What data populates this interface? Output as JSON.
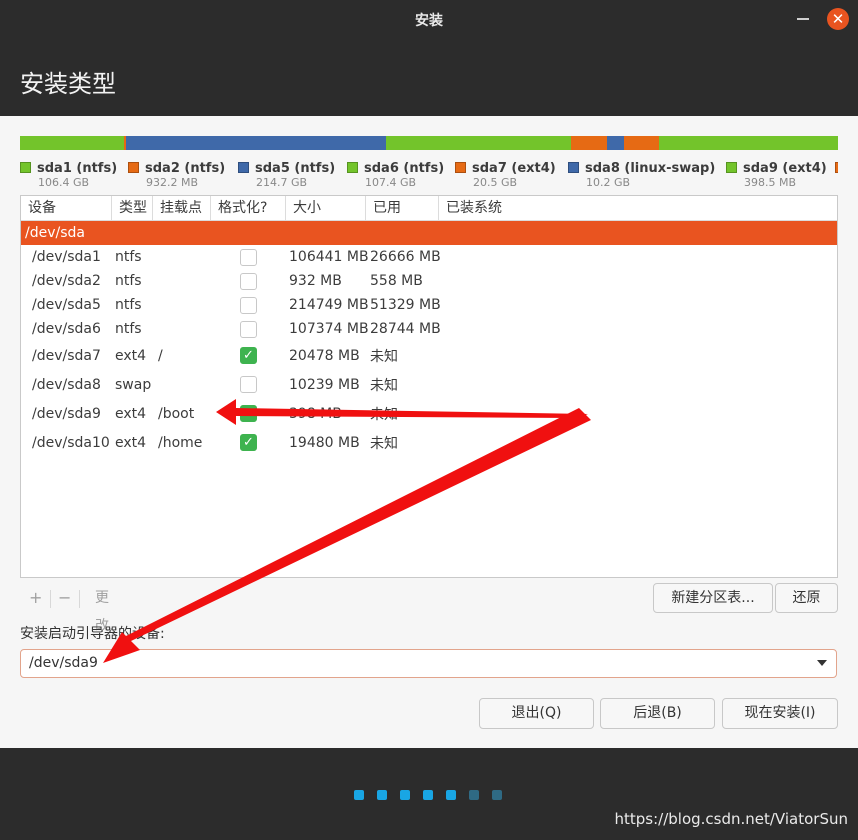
{
  "window": {
    "title": "安装",
    "close_glyph": "✕"
  },
  "header": {
    "title": "安装类型"
  },
  "partition_bar": {
    "segments": [
      {
        "color": "#73c42b",
        "share": 0.127
      },
      {
        "color": "#e66a14",
        "share": 0.003
      },
      {
        "color": "#3f69a9",
        "share": 0.318
      },
      {
        "color": "#73c42b",
        "share": 0.225
      },
      {
        "color": "#e66a14",
        "share": 0.044
      },
      {
        "color": "#3f69a9",
        "share": 0.021
      },
      {
        "color": "#e66a14",
        "share": 0.043
      },
      {
        "color": "#73c42b",
        "share": 0.219
      }
    ]
  },
  "legend": [
    {
      "name": "sda1 (ntfs)",
      "size": "106.4 GB",
      "color": "#73c42b"
    },
    {
      "name": "sda2 (ntfs)",
      "size": "932.2 MB",
      "color": "#e66a14"
    },
    {
      "name": "sda5 (ntfs)",
      "size": "214.7 GB",
      "color": "#3f69a9"
    },
    {
      "name": "sda6 (ntfs)",
      "size": "107.4 GB",
      "color": "#73c42b"
    },
    {
      "name": "sda7 (ext4)",
      "size": "20.5 GB",
      "color": "#e66a14"
    },
    {
      "name": "sda8 (linux-swap)",
      "size": "10.2 GB",
      "color": "#3f69a9"
    },
    {
      "name": "sda9 (ext4)",
      "size": "398.5 MB",
      "color": "#73c42b"
    },
    {
      "name": "",
      "size": "",
      "color": "#e66a14"
    }
  ],
  "table": {
    "headers": [
      "设备",
      "类型",
      "挂载点",
      "格式化?",
      "大小",
      "已用",
      "已装系统"
    ],
    "disk": "/dev/sda",
    "rows": [
      {
        "device": "/dev/sda1",
        "type": "ntfs",
        "mount": "",
        "format": false,
        "size": "106441 MB",
        "used": "26666 MB"
      },
      {
        "device": "/dev/sda2",
        "type": "ntfs",
        "mount": "",
        "format": false,
        "size": "932 MB",
        "used": "558 MB"
      },
      {
        "device": "/dev/sda5",
        "type": "ntfs",
        "mount": "",
        "format": false,
        "size": "214749 MB",
        "used": "51329 MB"
      },
      {
        "device": "/dev/sda6",
        "type": "ntfs",
        "mount": "",
        "format": false,
        "size": "107374 MB",
        "used": "28744 MB"
      },
      {
        "device": "/dev/sda7",
        "type": "ext4",
        "mount": "/",
        "format": true,
        "size": "20478 MB",
        "used": "未知"
      },
      {
        "device": "/dev/sda8",
        "type": "swap",
        "mount": "",
        "format": false,
        "size": "10239 MB",
        "used": "未知"
      },
      {
        "device": "/dev/sda9",
        "type": "ext4",
        "mount": "/boot",
        "format": true,
        "size": "398 MB",
        "used": "未知"
      },
      {
        "device": "/dev/sda10",
        "type": "ext4",
        "mount": "/home",
        "format": true,
        "size": "19480 MB",
        "used": "未知"
      }
    ]
  },
  "toolbar": {
    "add": "+",
    "remove": "−",
    "change": "更改..."
  },
  "buttons": {
    "new_table": "新建分区表...",
    "revert": "还原",
    "quit": "退出(Q)",
    "back": "后退(B)",
    "install_now": "现在安装(I)"
  },
  "bootloader": {
    "label": "安装启动引导器的设备:",
    "value": "/dev/sda9"
  },
  "progress_dots": {
    "total": 7,
    "done": 5,
    "done_color": "#19a6e4",
    "todo_color": "#2f6a84"
  },
  "watermark": "https://blog.csdn.net/ViatorSun",
  "annotation_color": "#f01010"
}
